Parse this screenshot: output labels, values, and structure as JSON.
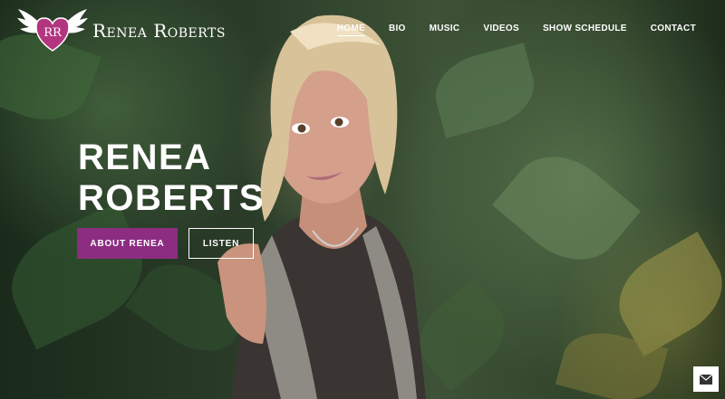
{
  "brand": {
    "name": "Renea Roberts",
    "monogram": "RR",
    "accent": "#8c2d82"
  },
  "nav": {
    "items": [
      {
        "label": "HOME",
        "active": true
      },
      {
        "label": "BIO",
        "active": false
      },
      {
        "label": "MUSIC",
        "active": false
      },
      {
        "label": "VIDEOS",
        "active": false
      },
      {
        "label": "SHOW SCHEDULE",
        "active": false
      },
      {
        "label": "CONTACT",
        "active": false
      }
    ]
  },
  "hero": {
    "headline_line1": "RENEA",
    "headline_line2": "ROBERTS",
    "primary_button": "ABOUT RENEA",
    "secondary_button": "LISTEN"
  },
  "icons": {
    "logo": "winged-heart-logo",
    "mail": "envelope-icon"
  }
}
